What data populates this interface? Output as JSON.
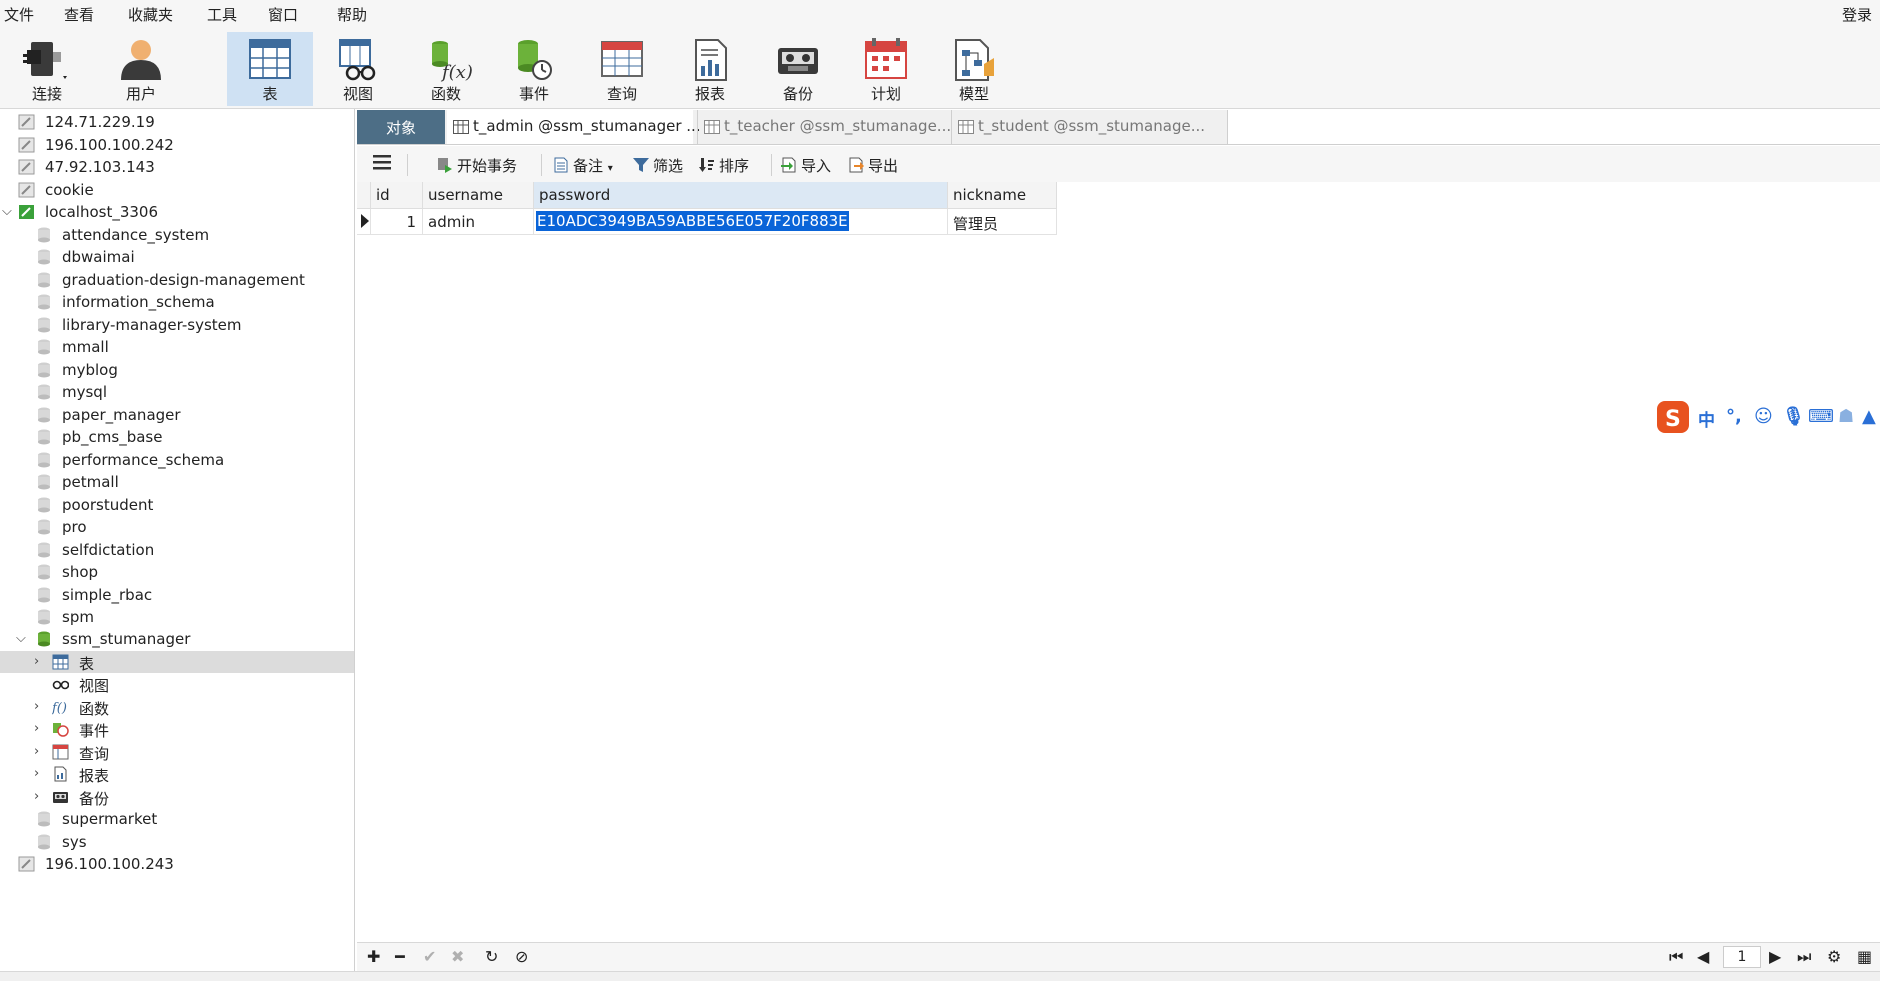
{
  "menu": [
    "文件",
    "查看",
    "收藏夹",
    "工具",
    "窗口",
    "帮助"
  ],
  "login_label": "登录",
  "toolbar": {
    "items": [
      {
        "label": "连接",
        "icon": "plug-icon"
      },
      {
        "label": "用户",
        "icon": "user-icon"
      },
      {
        "label": "表",
        "icon": "table-icon"
      },
      {
        "label": "视图",
        "icon": "view-icon"
      },
      {
        "label": "函数",
        "icon": "function-icon"
      },
      {
        "label": "事件",
        "icon": "event-icon"
      },
      {
        "label": "查询",
        "icon": "query-icon"
      },
      {
        "label": "报表",
        "icon": "report-icon"
      },
      {
        "label": "备份",
        "icon": "backup-icon"
      },
      {
        "label": "计划",
        "icon": "schedule-icon"
      },
      {
        "label": "模型",
        "icon": "model-icon"
      }
    ],
    "active": "表"
  },
  "sidebar": {
    "connections_top": [
      "124.71.229.19",
      "196.100.100.242",
      "47.92.103.143",
      "cookie"
    ],
    "localhost": "localhost_3306",
    "databases_before": [
      "attendance_system",
      "dbwaimai",
      "graduation-design-management",
      "information_schema",
      "library-manager-system",
      "mmall",
      "myblog",
      "mysql",
      "paper_manager",
      "pb_cms_base",
      "performance_schema",
      "petmall",
      "poorstudent",
      "pro",
      "selfdictation",
      "shop",
      "simple_rbac",
      "spm"
    ],
    "open_db": "ssm_stumanager",
    "open_db_children": [
      "表",
      "视图",
      "函数",
      "事件",
      "查询",
      "报表",
      "备份"
    ],
    "databases_after": [
      "supermarket",
      "sys"
    ],
    "connections_bottom": [
      "196.100.100.243"
    ]
  },
  "tabs": {
    "object": "对象",
    "items": [
      "t_admin @ssm_stumanager ...",
      "t_teacher @ssm_stumanage...",
      "t_student @ssm_stumanage..."
    ]
  },
  "objbar": {
    "begin_tx": "开始事务",
    "note": "备注",
    "filter": "筛选",
    "sort": "排序",
    "import": "导入",
    "export": "导出"
  },
  "grid": {
    "columns": [
      "id",
      "username",
      "password",
      "nickname"
    ],
    "rows": [
      {
        "id": "1",
        "username": "admin",
        "password": "E10ADC3949BA59ABBE56E057F20F883E",
        "nickname": "管理员"
      }
    ]
  },
  "pagination": {
    "page": "1"
  },
  "colors": {
    "accent": "#4d6e86",
    "selection": "#0a64d8",
    "active_tool": "#cfe1f3"
  }
}
